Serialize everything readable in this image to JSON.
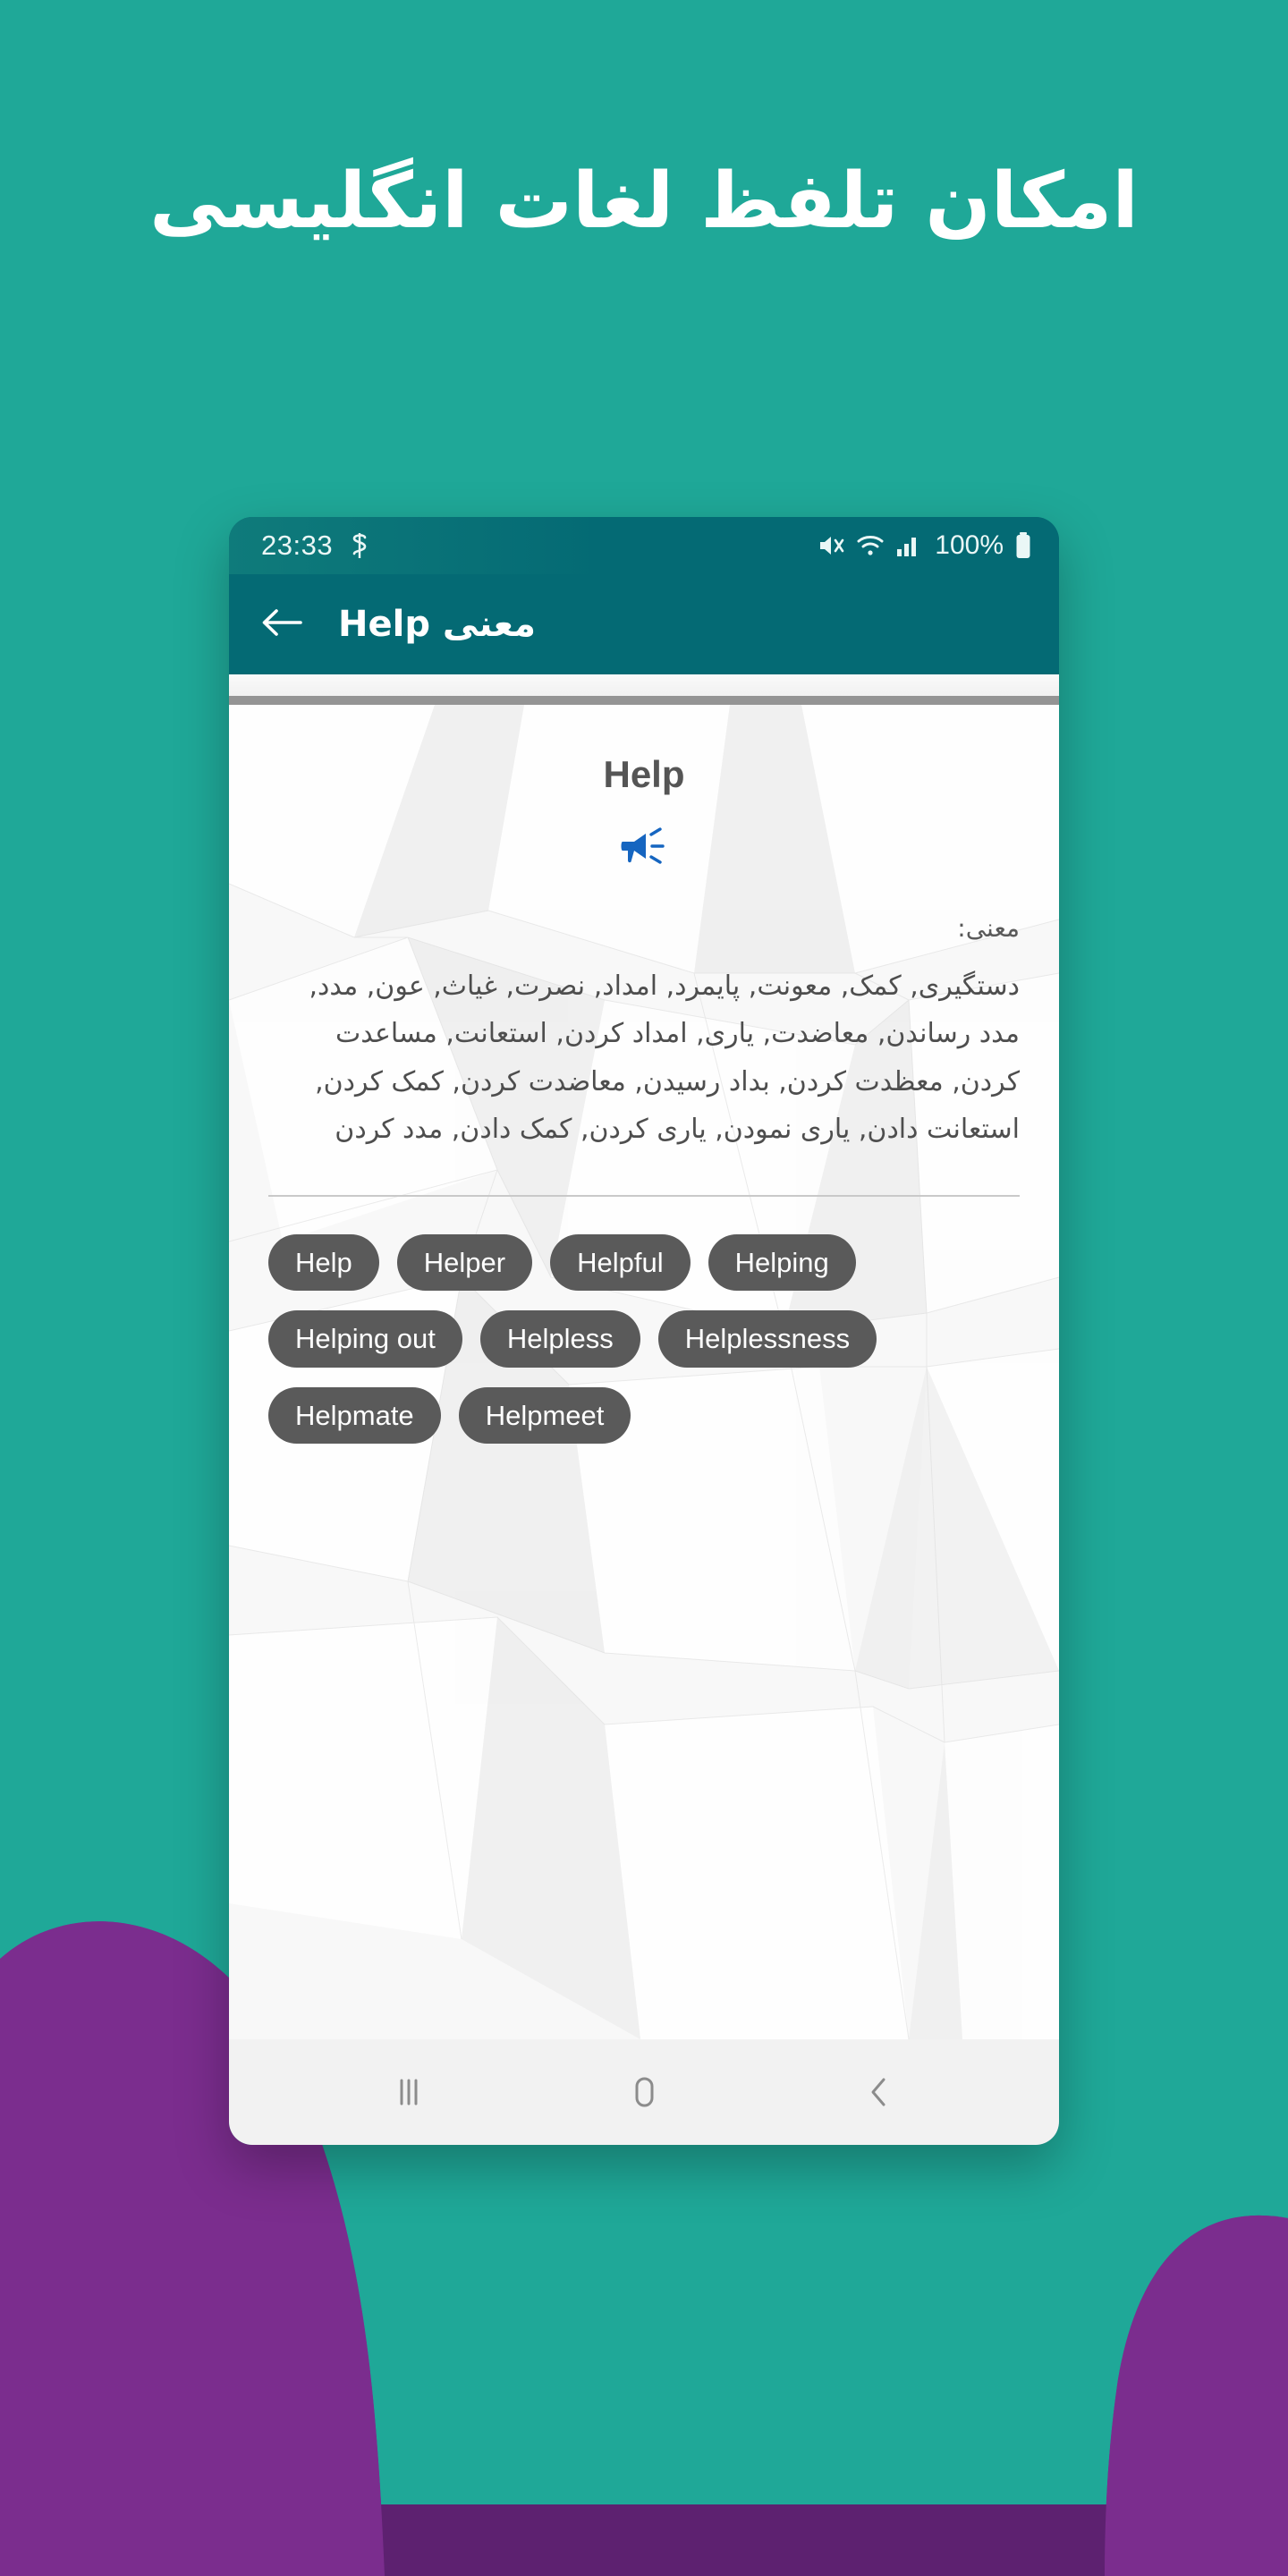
{
  "promo": {
    "headline": "امکان تلفظ لغات انگلیسی",
    "background_color": "#1FA898",
    "accent_color": "#7B2D8E"
  },
  "phone": {
    "status_bar": {
      "time": "23:33",
      "battery_percent": "100%",
      "app_icon": "app-glyph-icon",
      "icons": [
        "mute-icon",
        "wifi-icon",
        "signal-icon",
        "battery-icon"
      ]
    },
    "app_bar": {
      "back_icon": "back-arrow-icon",
      "title": "معنی Help"
    },
    "content": {
      "word": "Help",
      "pronounce_icon": "megaphone-icon",
      "meaning_label": "معنی:",
      "meaning_text": "دستگیری, کمک, معونت, پایمرد, امداد, نصرت, غیاث, عون, مدد, مدد رساندن, معاضدت, یاری, امداد کردن, استعانت, مساعدت کردن, معظدت کردن, بداد رسیدن, معاضدت کردن, کمک کردن, استعانت دادن, یاری نمودن, یاری کردن, کمک دادن, مدد کردن",
      "related_words": [
        "Help",
        "Helper",
        "Helpful",
        "Helping",
        "Helping out",
        "Helpless",
        "Helplessness",
        "Helpmate",
        "Helpmeet"
      ],
      "chip_color": "#5A5A5A",
      "pronounce_icon_color": "#1565C0"
    },
    "nav_bar": {
      "recents_icon": "recents-icon",
      "home_icon": "home-icon",
      "back_icon": "nav-back-icon"
    }
  }
}
